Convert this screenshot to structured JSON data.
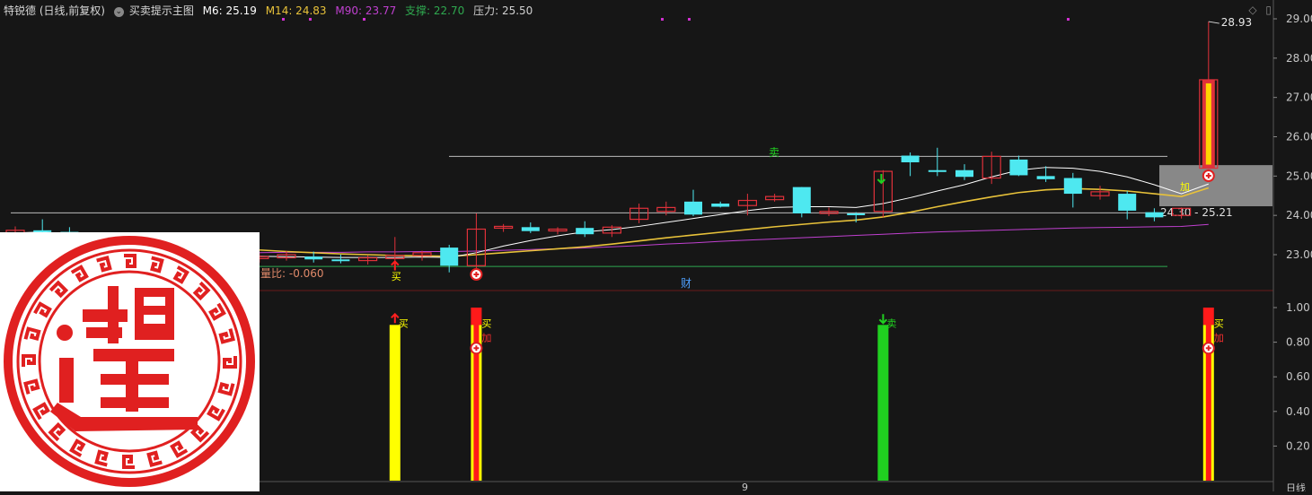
{
  "header": {
    "stock": "特锐德 (日线,前复权)",
    "indicator": "买卖提示主图",
    "m6": "M6: 25.19",
    "m14": "M14: 24.83",
    "m90": "M90: 23.77",
    "support": "支撑: 22.70",
    "pressure": "压力: 25.50"
  },
  "colors": {
    "bg": "#161616",
    "up": "#e0313a",
    "down": "#4ee8f0",
    "m6": "#ffffff",
    "m14": "#e8c23a",
    "m90": "#c040d0",
    "support": "#2fa84f",
    "pressure": "#d0d0d0",
    "buy_bar": "#ffff00",
    "sell_bar": "#20d020",
    "add_bar": "#ff1a1a",
    "signal_dots": "#d030d0",
    "axis_text": "#c8c8c8"
  },
  "labels": {
    "buy": "买",
    "sell": "卖",
    "add": "加",
    "cai": "财",
    "ratio": "量比: -0.060",
    "high_label": "28.93",
    "range_label": "24.30 - 25.21",
    "period": "日线",
    "date_tick": "9"
  },
  "icons": {
    "diamond": "◇",
    "panel": "▯",
    "chevron": "chevron-down-icon",
    "plus_circle": "add-position-icon"
  },
  "chart_data": [
    {
      "type": "candlestick",
      "name": "main",
      "ylim": [
        22.5,
        29.2
      ],
      "yticks": [
        "29.00",
        "28.00",
        "27.00",
        "26.00",
        "25.00",
        "24.00",
        "23.00"
      ],
      "ytick_values": [
        29,
        28,
        27,
        26,
        25,
        24,
        23
      ],
      "candles": [
        [
          23.48,
          23.72,
          23.38,
          23.62
        ],
        [
          23.62,
          23.9,
          23.5,
          23.58
        ],
        [
          23.58,
          23.7,
          23.3,
          23.4
        ],
        [
          23.4,
          23.55,
          23.1,
          23.2
        ],
        [
          23.2,
          23.4,
          23.05,
          23.3
        ],
        [
          23.3,
          23.35,
          22.95,
          23.0
        ],
        [
          23.0,
          23.15,
          22.88,
          23.05
        ],
        [
          23.08,
          23.15,
          22.8,
          22.85
        ],
        [
          22.88,
          23.0,
          22.78,
          22.92
        ],
        [
          22.9,
          23.05,
          22.8,
          22.95
        ],
        [
          22.92,
          23.1,
          22.85,
          23.0
        ],
        [
          22.95,
          23.08,
          22.8,
          22.88
        ],
        [
          22.88,
          23.0,
          22.78,
          22.85
        ],
        [
          22.85,
          22.98,
          22.75,
          22.92
        ],
        [
          22.9,
          23.45,
          22.8,
          22.98
        ],
        [
          22.98,
          23.1,
          22.85,
          23.05
        ],
        [
          23.18,
          23.25,
          22.55,
          22.72
        ],
        [
          22.72,
          24.05,
          22.55,
          23.65
        ],
        [
          23.68,
          23.78,
          23.58,
          23.72
        ],
        [
          23.7,
          23.82,
          23.55,
          23.6
        ],
        [
          23.62,
          23.7,
          23.52,
          23.65
        ],
        [
          23.68,
          23.85,
          23.45,
          23.52
        ],
        [
          23.55,
          23.75,
          23.45,
          23.7
        ],
        [
          23.9,
          24.3,
          23.8,
          24.18
        ],
        [
          24.1,
          24.35,
          24.0,
          24.2
        ],
        [
          24.35,
          24.65,
          23.98,
          24.02
        ],
        [
          24.3,
          24.35,
          24.2,
          24.22
        ],
        [
          24.25,
          24.55,
          24.0,
          24.38
        ],
        [
          24.4,
          24.55,
          24.35,
          24.48
        ],
        [
          24.72,
          24.72,
          23.95,
          24.05
        ],
        [
          24.05,
          24.2,
          23.98,
          24.1
        ],
        [
          24.05,
          24.08,
          23.82,
          24.02
        ],
        [
          24.1,
          25.15,
          23.95,
          25.12
        ],
        [
          25.52,
          25.6,
          25.0,
          25.35
        ],
        [
          25.15,
          25.72,
          25.0,
          25.12
        ],
        [
          25.15,
          25.3,
          24.9,
          24.98
        ],
        [
          24.95,
          25.62,
          24.8,
          25.5
        ],
        [
          25.42,
          25.52,
          25.0,
          25.02
        ],
        [
          25.0,
          25.25,
          24.85,
          24.92
        ],
        [
          24.95,
          25.08,
          24.2,
          24.55
        ],
        [
          24.5,
          24.75,
          24.4,
          24.6
        ],
        [
          24.55,
          24.62,
          23.9,
          24.12
        ],
        [
          24.08,
          24.18,
          23.85,
          23.95
        ],
        [
          24.0,
          24.2,
          23.92,
          24.18
        ],
        [
          25.2,
          28.93,
          25.18,
          27.45
        ]
      ],
      "m6": [
        23.55,
        23.58,
        23.52,
        23.42,
        23.33,
        23.22,
        23.12,
        23.02,
        22.98,
        22.96,
        22.95,
        22.94,
        22.93,
        22.93,
        22.93,
        22.94,
        22.93,
        23.05,
        23.22,
        23.36,
        23.48,
        23.58,
        23.64,
        23.72,
        23.82,
        23.92,
        24.02,
        24.12,
        24.2,
        24.22,
        24.22,
        24.2,
        24.3,
        24.45,
        24.62,
        24.78,
        24.98,
        25.15,
        25.22,
        25.2,
        25.12,
        24.98,
        24.78,
        24.55,
        24.8
      ],
      "m14": [
        23.5,
        23.5,
        23.48,
        23.45,
        23.42,
        23.38,
        23.32,
        23.25,
        23.18,
        23.12,
        23.08,
        23.05,
        23.02,
        23.0,
        22.98,
        22.97,
        22.96,
        23.0,
        23.05,
        23.1,
        23.15,
        23.2,
        23.27,
        23.35,
        23.43,
        23.5,
        23.57,
        23.64,
        23.71,
        23.77,
        23.83,
        23.88,
        23.96,
        24.08,
        24.22,
        24.35,
        24.47,
        24.58,
        24.65,
        24.68,
        24.66,
        24.62,
        24.55,
        24.48,
        24.7
      ],
      "m90": [
        23.05,
        23.05,
        23.05,
        23.05,
        23.05,
        23.05,
        23.05,
        23.05,
        23.05,
        23.05,
        23.06,
        23.06,
        23.06,
        23.07,
        23.07,
        23.08,
        23.08,
        23.09,
        23.11,
        23.13,
        23.15,
        23.17,
        23.2,
        23.23,
        23.27,
        23.3,
        23.34,
        23.37,
        23.4,
        23.43,
        23.46,
        23.49,
        23.52,
        23.55,
        23.58,
        23.6,
        23.62,
        23.64,
        23.66,
        23.68,
        23.69,
        23.7,
        23.71,
        23.72,
        23.77
      ],
      "support_level": 22.7,
      "pressure_level": 25.5,
      "range_low": 24.3,
      "range_high": 25.21,
      "high": 28.93
    },
    {
      "type": "bar",
      "name": "signal",
      "ylim": [
        0,
        1.0
      ],
      "yticks": [
        "1.00",
        "0.80",
        "0.60",
        "0.40",
        "0.20"
      ],
      "ytick_values": [
        1.0,
        0.8,
        0.6,
        0.4,
        0.2
      ],
      "series": [
        {
          "name": "买",
          "index": 14,
          "value": 0.9,
          "kind": "buy"
        },
        {
          "name": "买",
          "index": 17,
          "value": 1.0,
          "kind": "add"
        },
        {
          "name": "卖",
          "index": 32,
          "value": 0.9,
          "kind": "sell"
        },
        {
          "name": "买",
          "index": 44,
          "value": 1.0,
          "kind": "add"
        }
      ]
    }
  ]
}
